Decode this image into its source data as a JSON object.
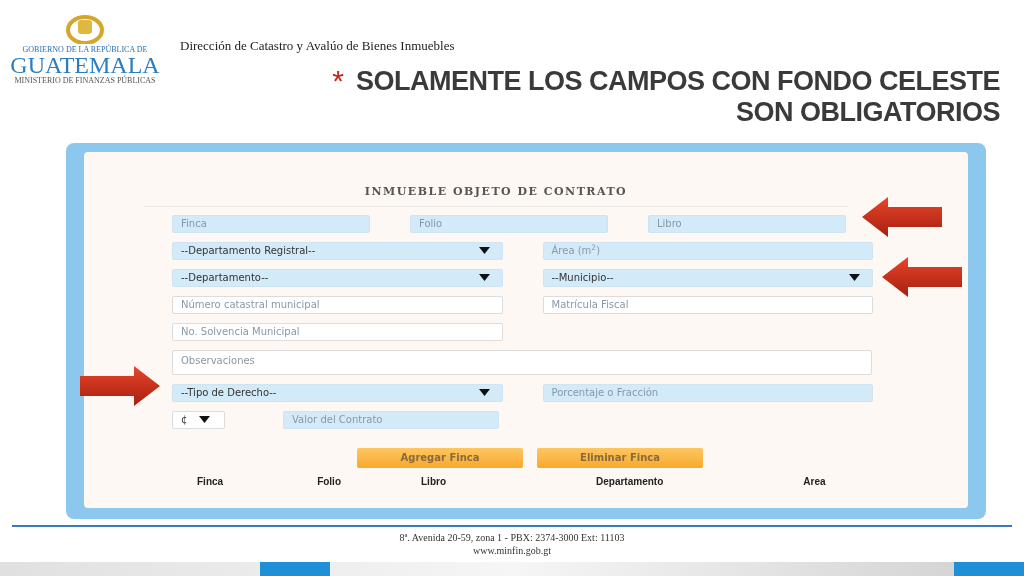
{
  "logo": {
    "top_line": "GOBIERNO DE LA REPÚBLICA DE",
    "name": "GUATEMALA",
    "bottom_line": "MINISTERIO DE FINANZAS PÚBLICAS"
  },
  "department": "Dirección de Catastro y Avalúo de Bienes Inmuebles",
  "notice": {
    "mark": "*",
    "lines": [
      "SOLAMENTE LOS CAMPOS CON FONDO CELESTE",
      "SON OBLIGATORIOS"
    ]
  },
  "form": {
    "title": "INMUEBLE OBJETO DE CONTRATO",
    "rows": [
      [
        {
          "kind": "text",
          "placeholder": "Finca",
          "required": true
        },
        {
          "kind": "text",
          "placeholder": "Folio",
          "required": true
        },
        {
          "kind": "text",
          "placeholder": "Libro",
          "required": true
        }
      ],
      [
        {
          "kind": "select",
          "value": "--Departamento Registral--",
          "required": true
        },
        {
          "kind": "text",
          "placeholder": "Área (m$^{2}$)",
          "required": true
        }
      ],
      [
        {
          "kind": "select",
          "value": "--Departamento--",
          "required": true
        },
        {
          "kind": "select",
          "value": "--Municipio--",
          "required": true
        }
      ],
      [
        {
          "kind": "text",
          "placeholder": "Número catastral municipal",
          "required": false
        },
        {
          "kind": "text",
          "placeholder": "Matrícula Fiscal",
          "required": false
        }
      ],
      [
        {
          "kind": "text",
          "placeholder": "No. Solvencia Municipal",
          "required": false
        }
      ],
      [
        {
          "kind": "textarea",
          "placeholder": "Observaciones",
          "required": false
        }
      ],
      [
        {
          "kind": "select",
          "value": "--Tipo de Derecho--",
          "required": true
        },
        {
          "kind": "text",
          "placeholder": "Porcentaje o Fracción",
          "required": true
        }
      ],
      [
        {
          "kind": "currency",
          "value": "¢",
          "required": false
        },
        {
          "kind": "text",
          "placeholder": "Valor del Contrato",
          "required": true
        }
      ]
    ],
    "buttons": [
      "Agregar Finca",
      "Eliminar Finca"
    ],
    "table": {
      "columns": [
        "Finca",
        "Folio",
        "Libro",
        "Departamento",
        "Area"
      ]
    }
  },
  "footer": {
    "address": "8ª. Avenida 20-59, zona 1 -  PBX: 2374-3000  Ext: 11103",
    "website": "www.minfin.gob.gt"
  }
}
